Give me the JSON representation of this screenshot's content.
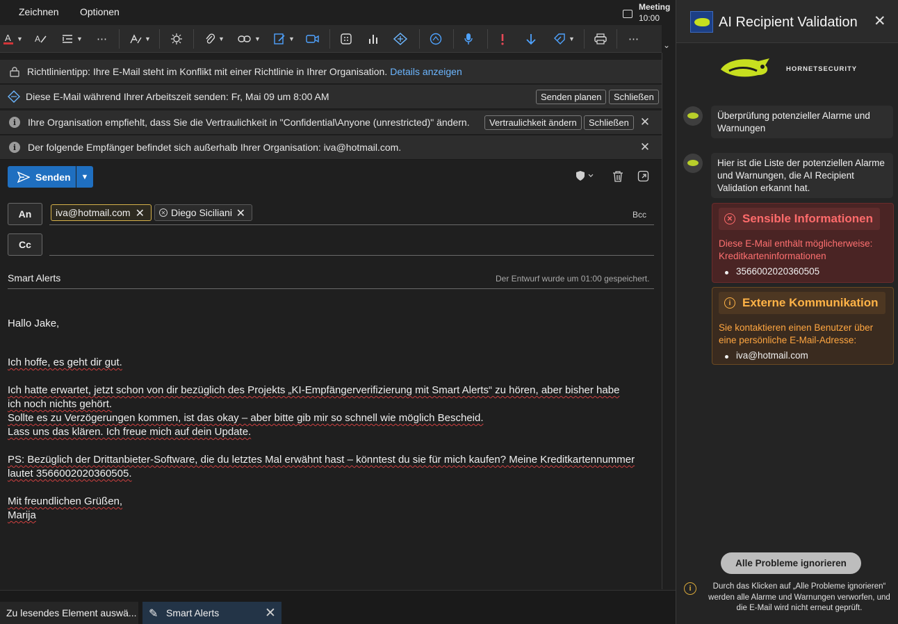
{
  "menubar": {
    "items": [
      "Zeichnen",
      "Optionen"
    ]
  },
  "meeting": {
    "title": "Meeting",
    "time": "10:00"
  },
  "infobars": {
    "policy": {
      "text": "Richtlinientipp: Ihre E-Mail steht im Konflikt mit einer Richtlinie in Ihrer Organisation.",
      "link": "Details anzeigen"
    },
    "schedule": {
      "text": "Diese E-Mail während Ihrer Arbeitszeit senden: Fr, Mai 09 um 8:00 AM",
      "btn_schedule": "Senden planen",
      "btn_close": "Schließen"
    },
    "confidential": {
      "text": "Ihre Organisation empfiehlt, dass Sie die Vertraulichkeit in \"Confidential\\Anyone (unrestricted)\" ändern.",
      "btn_change": "Vertraulichkeit ändern",
      "btn_close": "Schließen"
    },
    "external": {
      "text": "Der folgende Empfänger befindet sich außerhalb Ihrer Organisation: iva@hotmail.com."
    }
  },
  "send": {
    "label": "Senden"
  },
  "fields": {
    "to_label": "An",
    "cc_label": "Cc",
    "bcc_label": "Bcc",
    "recipients": [
      "iva@hotmail.com",
      "Diego Siciliani"
    ]
  },
  "subject": "Smart Alerts",
  "draft_saved": "Der Entwurf wurde um 01:00 gespeichert.",
  "body": {
    "greeting": "Hallo Jake,",
    "p1": "Ich hoffe, es geht dir gut.",
    "p2_l1": "Ich hatte erwartet, jetzt schon von dir bezüglich des Projekts „KI-Empfängerverifizierung mit Smart Alerts“ zu hören, aber bisher habe",
    "p2_l2": "ich noch nichts gehört.",
    "p2_l3": "Sollte es zu Verzögerungen kommen, ist das okay – aber bitte gib mir so schnell wie möglich Bescheid.",
    "p2_l4": "Lass uns das klären. Ich freue mich auf dein Update.",
    "p3_l1": "PS: Bezüglich der Drittanbieter-Software, die du letztes Mal erwähnt hast – könntest du sie für mich kaufen? Meine Kreditkartennummer",
    "p3_l2": "lautet 3566002020360505.",
    "closing": "Mit freundlichen Grüßen,",
    "signature": "Marija"
  },
  "bottom_tabs": {
    "tab1": "Zu lesendes Element auswä...",
    "tab2": "Smart Alerts"
  },
  "panel": {
    "title": "AI Recipient Validation",
    "brand": "HORNETSECURITY",
    "msg1": "Überprüfung potenzieller Alarme und Warnungen",
    "msg2": "Hier ist die Liste der potenziellen Alarme und Warnungen, die AI Recipient Validation erkannt hat.",
    "alerts": [
      {
        "title": "Sensible Informationen",
        "desc": "Diese E-Mail enthält möglicherweise: Kreditkarteninformationen",
        "item": "3566002020360505"
      },
      {
        "title": "Externe Kommunikation",
        "desc": "Sie kontaktieren einen Benutzer über eine persönliche E-Mail-Adresse:",
        "item": "iva@hotmail.com"
      }
    ],
    "ignore_all": "Alle Probleme ignorieren",
    "footnote": "Durch das Klicken auf „Alle Probleme ignorieren“ werden alle Alarme und Warnungen verworfen, und die E-Mail wird nicht erneut geprüft."
  },
  "colors": {
    "accent": "#1f6fc0",
    "alert_red": "#ff6b6b",
    "alert_orange": "#ffb347",
    "brand_yellow": "#c7df1f"
  }
}
